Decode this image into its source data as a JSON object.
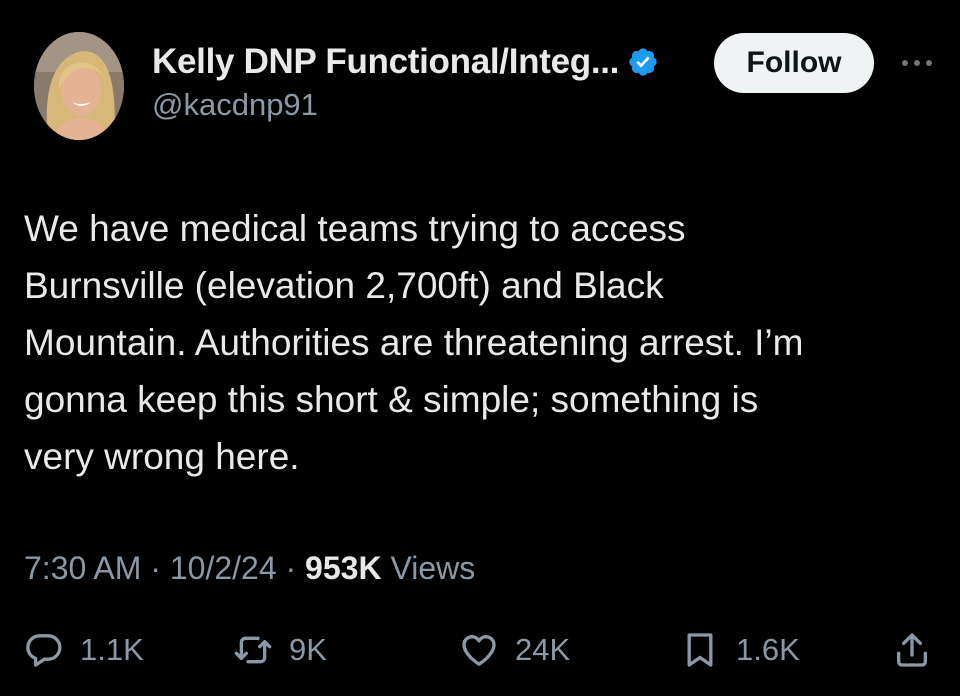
{
  "author": {
    "name": "Kelly DNP Functional/Integ...",
    "handle": "@kacdnp91",
    "verified_icon": "verified-badge-icon",
    "verified_color": "#1d9bf0"
  },
  "follow_button": {
    "label": "Follow"
  },
  "more_button": {
    "icon": "more-horizontal-icon"
  },
  "tweet": {
    "lines": [
      "We have medical teams trying to access",
      "Burnsville (elevation 2,700ft) and Black",
      "Mountain. Authorities are threatening arrest. I’m",
      "gonna keep this short & simple; something is",
      "very wrong here."
    ]
  },
  "meta": {
    "time": "7:30 AM",
    "separator": " · ",
    "date": "10/2/24",
    "views_count": "953K",
    "views_label": " Views"
  },
  "actions": {
    "replies": "1.1K",
    "reposts": "9K",
    "likes": "24K",
    "bookmarks": "1.6K"
  },
  "colors": {
    "background": "#000000",
    "text": "#e7e9ea",
    "muted": "#8b98a5",
    "follow_bg": "#eff3f4"
  }
}
